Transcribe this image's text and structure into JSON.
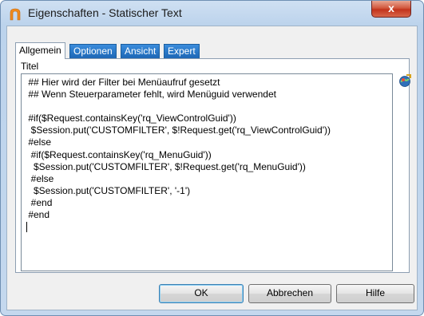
{
  "window": {
    "title": "Eigenschaften - Statischer Text",
    "close_label": "x"
  },
  "tabs": [
    {
      "label": "Allgemein",
      "active": true
    },
    {
      "label": "Optionen",
      "active": false
    },
    {
      "label": "Ansicht",
      "active": false
    },
    {
      "label": "Expert",
      "active": false
    }
  ],
  "field": {
    "label": "Titel",
    "lines": [
      " ## Hier wird der Filter bei Menüaufruf gesetzt",
      " ## Wenn Steuerparameter fehlt, wird Menüguid verwendet",
      "",
      " #if($Request.containsKey('rq_ViewControlGuid'))",
      "  $Session.put('CUSTOMFILTER', $!Request.get('rq_ViewControlGuid'))",
      " #else",
      "  #if($Request.containsKey('rq_MenuGuid'))",
      "   $Session.put('CUSTOMFILTER', $!Request.get('rq_MenuGuid'))",
      "  #else",
      "   $Session.put('CUSTOMFILTER', '-1')",
      "  #end",
      " #end"
    ]
  },
  "buttons": {
    "ok": "OK",
    "cancel": "Abbrechen",
    "help": "Hilfe"
  },
  "icons": {
    "app": "window-app-icon",
    "side": "expression-editor-icon"
  }
}
